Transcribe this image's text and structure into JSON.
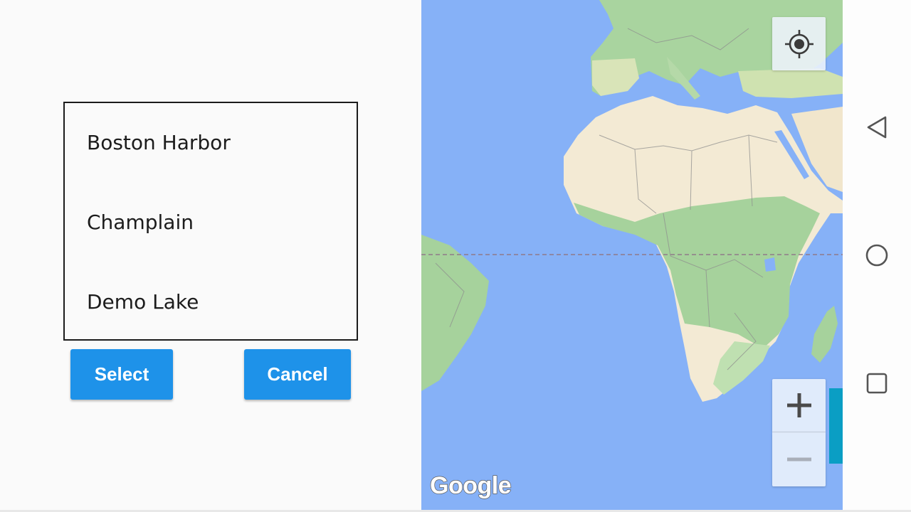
{
  "location_list": {
    "items": [
      {
        "label": "Boston Harbor"
      },
      {
        "label": "Champlain"
      },
      {
        "label": "Demo Lake"
      }
    ]
  },
  "buttons": {
    "select_label": "Select",
    "cancel_label": "Cancel"
  },
  "map": {
    "attribution": "Google",
    "controls": {
      "zoom_in_icon": "plus-icon",
      "zoom_out_icon": "minus-icon",
      "locate_icon": "my-location-icon"
    }
  },
  "navigation_bar": {
    "icons": [
      "back-triangle-icon",
      "home-circle-icon",
      "recents-square-icon"
    ]
  },
  "colors": {
    "button": "#1e92e9",
    "ocean": "#86b1f7",
    "land_desert": "#f3ead4",
    "land_vegetation": "#a6d29c",
    "equator_line": "#8f7a8a"
  }
}
